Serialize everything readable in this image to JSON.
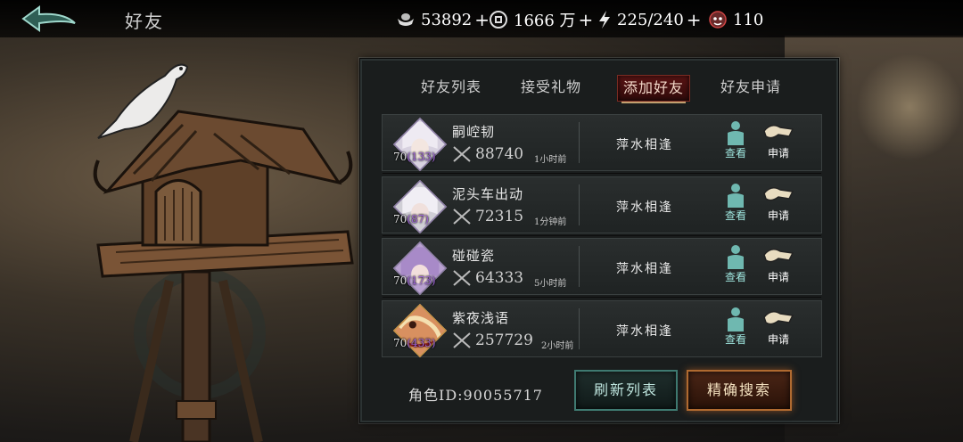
{
  "header": {
    "title": "好友",
    "resources": [
      {
        "icon": "silver-ingot-icon",
        "value": "53892"
      },
      {
        "icon": "coin-icon",
        "value": "1666 万"
      },
      {
        "icon": "lightning-icon",
        "value": "225/240"
      },
      {
        "icon": "demon-mask-icon",
        "value": "110"
      }
    ]
  },
  "tabs": [
    {
      "label": "好友列表",
      "active": false
    },
    {
      "label": "接受礼物",
      "active": false
    },
    {
      "label": "添加好友",
      "active": true
    },
    {
      "label": "好友申请",
      "active": false
    }
  ],
  "players": [
    {
      "name": "嗣崆韧",
      "level": "70",
      "level_sub": "(133)",
      "power": "88740",
      "last_online": "1小时前",
      "status": "萍水相逢",
      "view_label": "查看",
      "apply_label": "申请"
    },
    {
      "name": "泥头车出动",
      "level": "70",
      "level_sub": "(87)",
      "power": "72315",
      "last_online": "1分钟前",
      "status": "萍水相逢",
      "view_label": "查看",
      "apply_label": "申请"
    },
    {
      "name": "碰碰瓷",
      "level": "70",
      "level_sub": "(173)",
      "power": "64333",
      "last_online": "5小时前",
      "status": "萍水相逢",
      "view_label": "查看",
      "apply_label": "申请"
    },
    {
      "name": "紫夜浅语",
      "level": "70",
      "level_sub": "(433)",
      "power": "257729",
      "last_online": "2小时前",
      "status": "萍水相逢",
      "view_label": "查看",
      "apply_label": "申请"
    }
  ],
  "footer": {
    "role_id": "角色ID:90055717",
    "refresh_label": "刷新列表",
    "search_label": "精确搜索"
  },
  "colors": {
    "accent_teal": "#3f7a71",
    "accent_red": "#5a1414",
    "accent_orange": "#b06a30"
  }
}
